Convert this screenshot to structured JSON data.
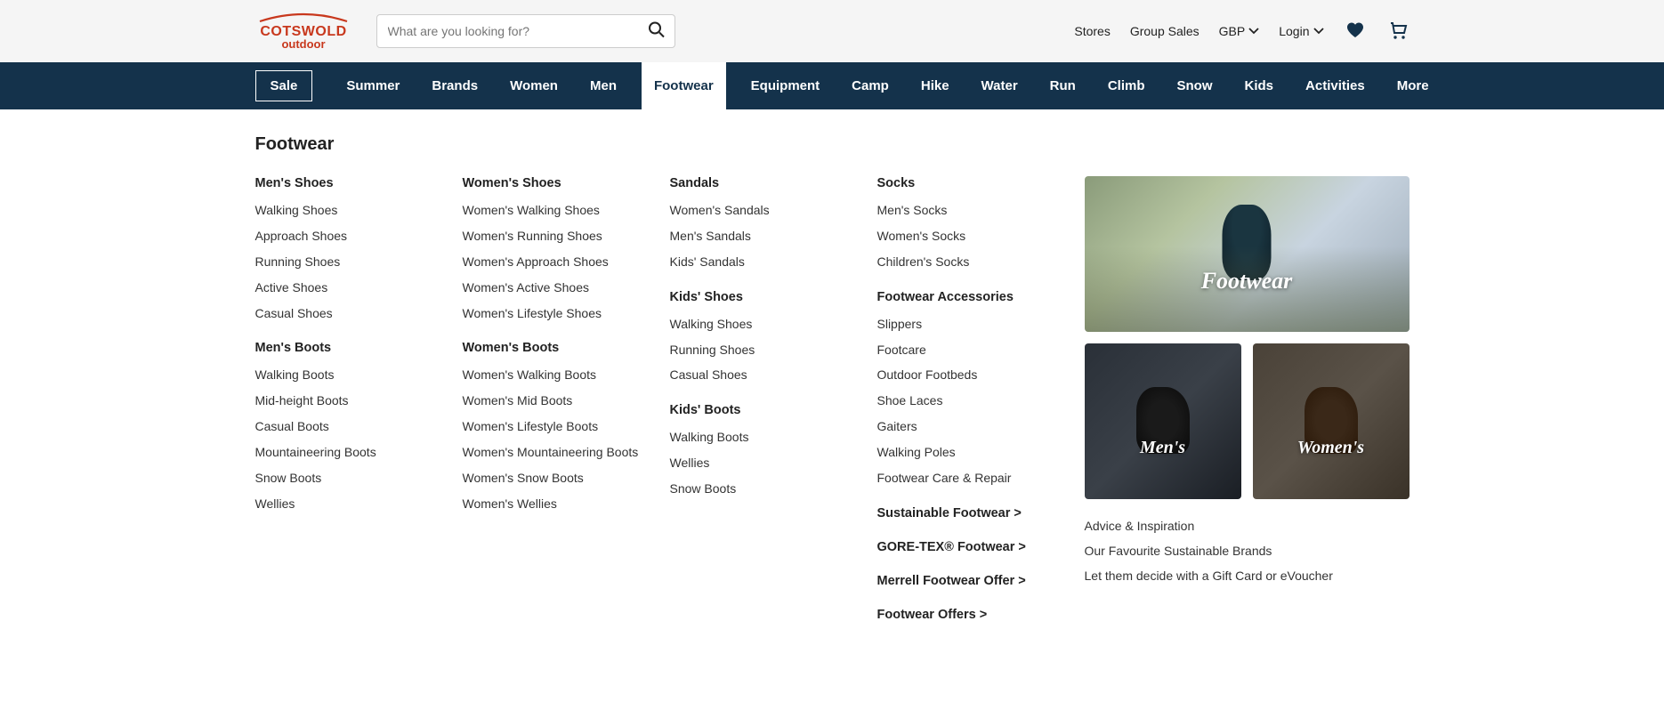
{
  "header": {
    "logo_main": "COTSWOLD",
    "logo_sub": "outdoor",
    "search_placeholder": "What are you looking for?",
    "links": {
      "stores": "Stores",
      "group_sales": "Group Sales",
      "currency": "GBP",
      "login": "Login"
    }
  },
  "nav": {
    "sale": "Sale",
    "items": [
      "Summer",
      "Brands",
      "Women",
      "Men",
      "Footwear",
      "Equipment",
      "Camp",
      "Hike",
      "Water",
      "Run",
      "Climb",
      "Snow",
      "Kids",
      "Activities",
      "More"
    ],
    "active_index": 4
  },
  "mega": {
    "title": "Footwear",
    "columns": [
      {
        "sections": [
          {
            "heading": "Men's Shoes",
            "links": [
              "Walking Shoes",
              "Approach Shoes",
              "Running Shoes",
              "Active Shoes",
              "Casual Shoes"
            ]
          },
          {
            "heading": "Men's Boots",
            "links": [
              "Walking Boots",
              "Mid-height Boots",
              "Casual Boots",
              "Mountaineering Boots",
              "Snow Boots",
              "Wellies"
            ]
          }
        ]
      },
      {
        "sections": [
          {
            "heading": "Women's Shoes",
            "links": [
              "Women's Walking Shoes",
              "Women's Running Shoes",
              "Women's Approach Shoes",
              "Women's Active Shoes",
              "Women's Lifestyle Shoes"
            ]
          },
          {
            "heading": "Women's Boots",
            "links": [
              "Women's Walking Boots",
              "Women's Mid Boots",
              "Women's Lifestyle Boots",
              "Women's Mountaineering Boots",
              "Women's Snow Boots",
              "Women's Wellies"
            ]
          }
        ]
      },
      {
        "sections": [
          {
            "heading": "Sandals",
            "links": [
              "Women's Sandals",
              "Men's Sandals",
              "Kids' Sandals"
            ]
          },
          {
            "heading": "Kids' Shoes",
            "links": [
              "Walking Shoes",
              "Running Shoes",
              "Casual Shoes"
            ]
          },
          {
            "heading": "Kids' Boots",
            "links": [
              "Walking Boots",
              "Wellies",
              "Snow Boots"
            ]
          }
        ]
      },
      {
        "sections": [
          {
            "heading": "Socks",
            "links": [
              "Men's Socks",
              "Women's Socks",
              "Children's Socks"
            ]
          },
          {
            "heading": "Footwear Accessories",
            "links": [
              "Slippers",
              "Footcare",
              "Outdoor Footbeds",
              "Shoe Laces",
              "Gaiters",
              "Walking Poles",
              "Footwear Care & Repair"
            ]
          }
        ],
        "promos": [
          "Sustainable Footwear >",
          "GORE-TEX® Footwear >",
          "Merrell Footwear Offer >",
          "Footwear Offers >"
        ]
      }
    ],
    "side": {
      "banner_main": "Footwear",
      "banner_mens": "Men's",
      "banner_womens": "Women's",
      "links": [
        "Advice & Inspiration",
        "Our Favourite Sustainable Brands",
        "Let them decide with a Gift Card or eVoucher"
      ]
    }
  }
}
